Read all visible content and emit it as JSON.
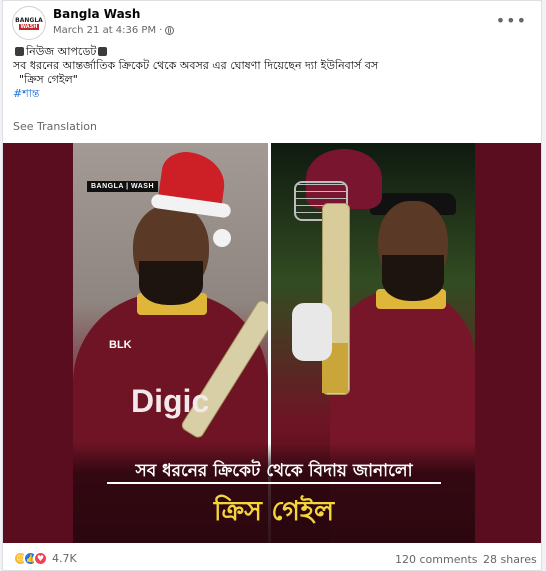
{
  "post": {
    "page_name": "Bangla Wash",
    "avatar_logo_top": "BANGLA",
    "avatar_logo_bottom": "WASH",
    "timestamp": "March 21 at 4:36 PM",
    "more_label": "•••",
    "text_line1": "নিউজ আপডেট",
    "text_line2": "সব ধরনের আন্তর্জাতিক ক্রিকেট থেকে অবসর এর ঘোষণা দিয়েছেন দ্যা ইউনিবার্স বস",
    "text_line3": "\"ক্রিস গেইল\"",
    "hashtag": "#শান্ত",
    "see_translation": "See Translation"
  },
  "media": {
    "brand_tag": "BANGLA | WASH",
    "jersey_logo": "BLK",
    "jersey_text": "Digic",
    "caption_line1": "সব ধরনের ক্রিকেট থেকে বিদায় জানালো",
    "caption_line2": "ক্রিস গেইল"
  },
  "footer": {
    "reactions": [
      "sad-reaction",
      "like-reaction",
      "love-reaction"
    ],
    "reaction_count": "4.7K",
    "comments": "120 comments",
    "shares": "28 shares"
  },
  "colors": {
    "maroon_bg": "#5a0d1f",
    "caption_gold": "#f4d63a",
    "hashtag_blue": "#216fdb"
  }
}
